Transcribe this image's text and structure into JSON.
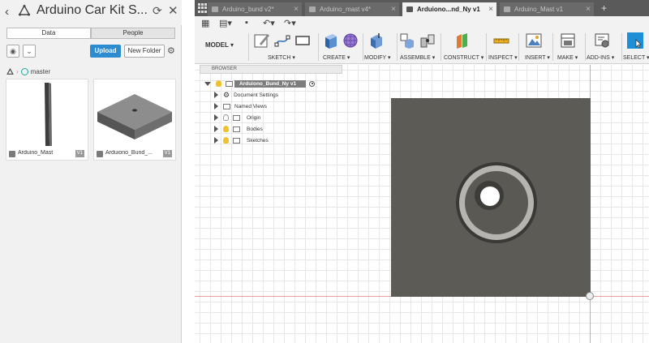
{
  "data_panel": {
    "title": "Arduino Car Kit S...",
    "tabs": [
      {
        "label": "Data",
        "active": true
      },
      {
        "label": "People",
        "active": false
      }
    ],
    "upload_label": "Upload",
    "new_folder_label": "New Folder",
    "breadcrumb_branch": "master",
    "files": [
      {
        "name": "Arduino_Mast",
        "version": "V1"
      },
      {
        "name": "Arduiono_Bund_...",
        "version": "V1"
      }
    ]
  },
  "doc_tabs": [
    {
      "label": "Arduino_bund v2*",
      "active": false
    },
    {
      "label": "Arduino_mast v4*",
      "active": false
    },
    {
      "label": "Arduiono...nd_Ny v1",
      "active": true
    },
    {
      "label": "Arduino_Mast v1",
      "active": false
    }
  ],
  "toolbar": {
    "workspace": "MODEL",
    "groups": [
      {
        "label": "SKETCH",
        "icons": [
          "sketch-pencil-icon",
          "line-icon",
          "rectangle-icon"
        ]
      },
      {
        "label": "CREATE",
        "icons": [
          "extrude-box-icon",
          "mesh-sphere-icon"
        ]
      },
      {
        "label": "MODIFY",
        "icons": [
          "press-pull-icon"
        ]
      },
      {
        "label": "ASSEMBLE",
        "icons": [
          "new-component-icon",
          "joint-icon"
        ]
      },
      {
        "label": "CONSTRUCT",
        "icons": [
          "plane-icon"
        ]
      },
      {
        "label": "INSPECT",
        "icons": [
          "measure-icon"
        ]
      },
      {
        "label": "INSERT",
        "icons": [
          "image-icon"
        ]
      },
      {
        "label": "MAKE",
        "icons": [
          "printer-icon"
        ]
      },
      {
        "label": "ADD-INS",
        "icons": [
          "addins-icon"
        ]
      },
      {
        "label": "SELECT",
        "icons": [
          "select-cursor-icon"
        ]
      }
    ]
  },
  "browser": {
    "header": "BROWSER",
    "root": "Arduiono_Bund_Ny v1",
    "items": [
      {
        "label": "Document Settings",
        "icon": "gear-icon"
      },
      {
        "label": "Named Views",
        "icon": "folder-icon"
      },
      {
        "label": "Origin",
        "icon": "folder-icon"
      },
      {
        "label": "Bodies",
        "icon": "folder-icon"
      },
      {
        "label": "Sketches",
        "icon": "folder-icon"
      }
    ]
  },
  "colors": {
    "accent": "#2d8bd0",
    "tabbar": "#5a5a5a",
    "part_face": "#5d5b55"
  }
}
